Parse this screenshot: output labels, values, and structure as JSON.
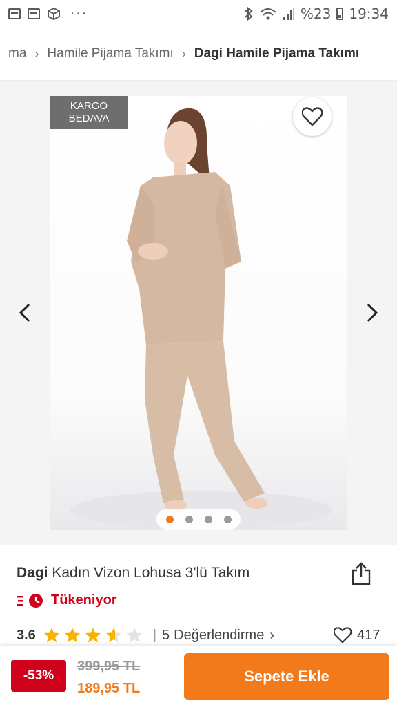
{
  "status_bar": {
    "left_icons": [
      "calendar-icon",
      "calendar-icon",
      "box-icon"
    ],
    "more": "···",
    "battery_percent": "%23",
    "time": "19:34"
  },
  "breadcrumb": {
    "items": [
      "ma",
      "Hamile Pijama Takımı",
      "Dagi Hamile Pijama Takımı"
    ]
  },
  "gallery": {
    "badge_line1": "KARGO",
    "badge_line2": "BEDAVA",
    "image_count": 4,
    "active_index": 0
  },
  "product": {
    "brand": "Dagi",
    "name": "Kadın Vizon Lohusa 3'lü Takım",
    "stock_status": "Tükeniyor",
    "rating": "3.6",
    "rating_value": 3.6,
    "review_count": "5",
    "review_label": "Değerlendirme",
    "favorites": "417"
  },
  "price": {
    "discount": "-53%",
    "old": "399,95 TL",
    "new": "189,95 TL"
  },
  "actions": {
    "add_to_cart": "Sepete Ekle"
  },
  "colors": {
    "accent": "#f27a1a",
    "discount_red": "#d0021b",
    "star": "#f5b400"
  }
}
